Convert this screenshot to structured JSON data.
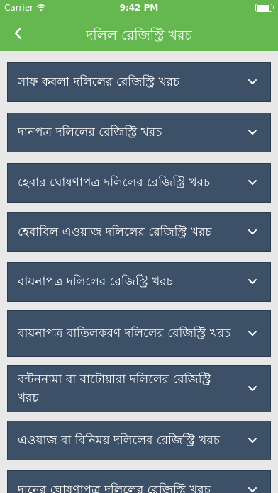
{
  "status_bar": {
    "carrier": "Carrier",
    "time": "9:42 PM",
    "battery_level": 0.95
  },
  "nav": {
    "title": "দলিল রেজিস্ট্রি খরচ",
    "back_icon": "chevron-left-icon"
  },
  "items": [
    {
      "label": "সাফ কবলা দলিলের রেজিস্ট্রি খরচ"
    },
    {
      "label": "দানপত্র দলিলের রেজিস্ট্রি খরচ"
    },
    {
      "label": "হেবার ঘোষণাপত্র দলিলের রেজিস্ট্রি খরচ"
    },
    {
      "label": "হেবাবিল এওয়াজ দলিলের রেজিস্ট্রি খরচ"
    },
    {
      "label": "বায়নাপত্র দলিলের রেজিস্ট্রি খরচ"
    },
    {
      "label": "বায়নাপত্র বাতিলকরণ দলিলের রেজিস্ট্রি খরচ"
    },
    {
      "label": "বন্টননামা বা বাটোয়ারা দলিলের রেজিস্ট্রি খরচ"
    },
    {
      "label": "এওয়াজ বা বিনিময় দলিলের রেজিস্ট্রি খরচ"
    },
    {
      "label": "দানের ঘোষণাপত্র দলিলের রেজিস্ট্রি খরচ"
    }
  ],
  "colors": {
    "header": "#65b74f",
    "item_bg": "#3c5068",
    "page_bg": "#e8e8e8"
  }
}
